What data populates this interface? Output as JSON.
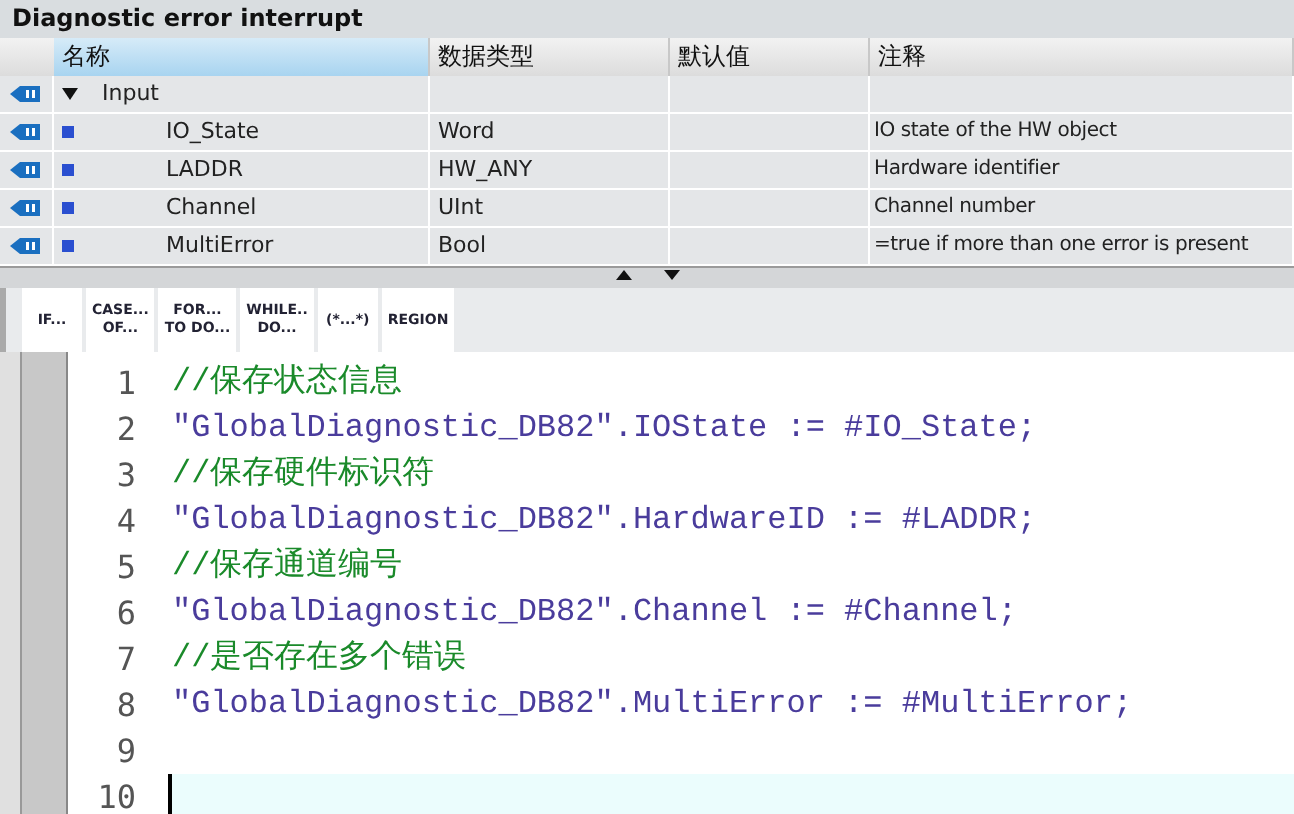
{
  "title": "Diagnostic error interrupt",
  "table": {
    "columns": [
      "名称",
      "数据类型",
      "默认值",
      "注释"
    ],
    "rows": [
      {
        "kind": "group",
        "expanded": true,
        "name": "Input"
      },
      {
        "kind": "member",
        "name": "IO_State",
        "type": "Word",
        "comment": "IO state of the HW object"
      },
      {
        "kind": "member",
        "name": "LADDR",
        "type": "HW_ANY",
        "comment": "Hardware identifier"
      },
      {
        "kind": "member",
        "name": "Channel",
        "type": "UInt",
        "comment": "Channel number"
      },
      {
        "kind": "member",
        "name": "MultiError",
        "type": "Bool",
        "comment": "=true if more than one error is present"
      }
    ]
  },
  "toolbar": [
    [
      "IF..."
    ],
    [
      "CASE...",
      "OF..."
    ],
    [
      "FOR...",
      "TO DO..."
    ],
    [
      "WHILE..",
      "DO..."
    ],
    [
      "(*...*)"
    ],
    [
      "REGION"
    ]
  ],
  "code": [
    {
      "number": "1",
      "kind": "comment",
      "text": "//保存状态信息",
      "current": false
    },
    {
      "number": "2",
      "kind": "code",
      "text": "\"GlobalDiagnostic_DB82\".IOState := #IO_State;",
      "current": false
    },
    {
      "number": "3",
      "kind": "comment",
      "text": "//保存硬件标识符",
      "current": false
    },
    {
      "number": "4",
      "kind": "code",
      "text": "\"GlobalDiagnostic_DB82\".HardwareID := #LADDR;",
      "current": false
    },
    {
      "number": "5",
      "kind": "comment",
      "text": "//保存通道编号",
      "current": false
    },
    {
      "number": "6",
      "kind": "code",
      "text": "\"GlobalDiagnostic_DB82\".Channel := #Channel;",
      "current": false
    },
    {
      "number": "7",
      "kind": "comment",
      "text": "//是否存在多个错误",
      "current": false
    },
    {
      "number": "8",
      "kind": "code",
      "text": "\"GlobalDiagnostic_DB82\".MultiError := #MultiError;",
      "current": false
    },
    {
      "number": "9",
      "kind": "code",
      "current": false
    },
    {
      "number": "10",
      "kind": "code",
      "current": true
    }
  ]
}
